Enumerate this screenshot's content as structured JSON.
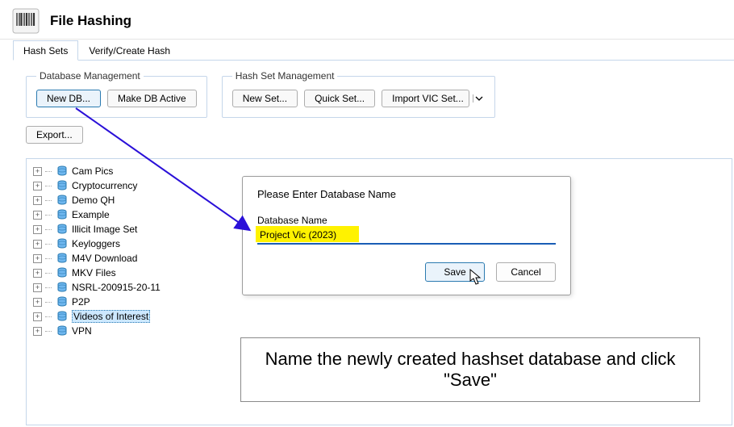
{
  "header": {
    "title": "File Hashing"
  },
  "tabs": [
    {
      "label": "Hash Sets",
      "active": true
    },
    {
      "label": "Verify/Create Hash",
      "active": false
    }
  ],
  "groups": {
    "db": {
      "legend": "Database Management",
      "new_db": "New DB...",
      "make_active": "Make DB Active"
    },
    "hashset": {
      "legend": "Hash Set Management",
      "new_set": "New Set...",
      "quick_set": "Quick Set...",
      "import_vic": "Import VIC Set..."
    }
  },
  "export_label": "Export...",
  "tree": [
    "Cam Pics",
    "Cryptocurrency",
    "Demo QH",
    "Example",
    "Illicit Image Set",
    "Keyloggers",
    "M4V Download",
    "MKV Files",
    "NSRL-200915-20-11",
    "P2P",
    "Videos of Interest",
    "VPN"
  ],
  "tree_selected_index": 10,
  "dialog": {
    "title": "Please Enter Database Name",
    "field_label": "Database Name",
    "value": "Project Vic (2023)",
    "save": "Save",
    "cancel": "Cancel"
  },
  "instruction_text": "Name the newly created hashset database and click \"Save\""
}
